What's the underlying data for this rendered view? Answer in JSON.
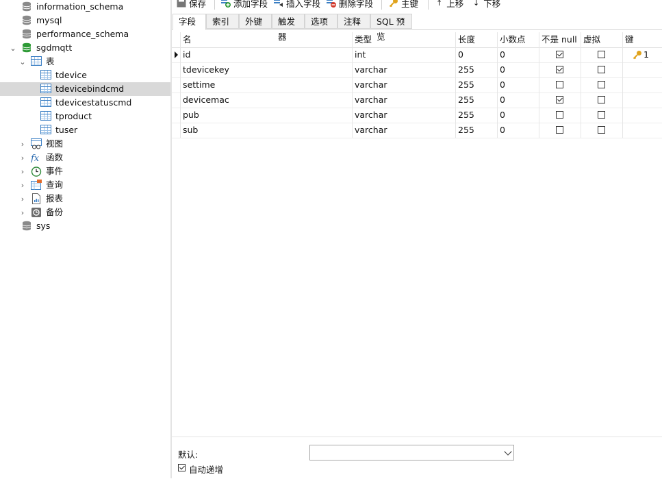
{
  "tree": {
    "items": [
      {
        "label": "information_schema",
        "icon": "database-icon"
      },
      {
        "label": "mysql",
        "icon": "database-icon"
      },
      {
        "label": "performance_schema",
        "icon": "database-icon"
      },
      {
        "label": "sgdmqtt",
        "icon": "database-open-icon"
      },
      {
        "label": "表",
        "icon": "tables-folder-icon"
      },
      {
        "label": "tdevice",
        "icon": "table-icon"
      },
      {
        "label": "tdevicebindcmd",
        "icon": "table-icon"
      },
      {
        "label": "tdevicestatuscmd",
        "icon": "table-icon"
      },
      {
        "label": "tproduct",
        "icon": "table-icon"
      },
      {
        "label": "tuser",
        "icon": "table-icon"
      },
      {
        "label": "视图",
        "icon": "view-icon"
      },
      {
        "label": "函数",
        "icon": "function-icon"
      },
      {
        "label": "事件",
        "icon": "event-clock-icon"
      },
      {
        "label": "查询",
        "icon": "query-icon"
      },
      {
        "label": "报表",
        "icon": "report-icon"
      },
      {
        "label": "备份",
        "icon": "backup-icon"
      },
      {
        "label": "sys",
        "icon": "database-icon"
      }
    ]
  },
  "toolbar": {
    "save": "保存",
    "add_field": "添加字段",
    "insert_field": "插入字段",
    "delete_field": "删除字段",
    "primary_key": "主键",
    "move_up": "上移",
    "move_down": "下移"
  },
  "tabs": [
    "字段",
    "索引",
    "外键",
    "触发器",
    "选项",
    "注释",
    "SQL 预览"
  ],
  "grid": {
    "headers": [
      "名",
      "类型",
      "长度",
      "小数点",
      "不是 null",
      "虚拟",
      "键"
    ],
    "rows": [
      {
        "name": "id",
        "type": "int",
        "length": "0",
        "decimals": "0",
        "not_null": true,
        "virtual": false,
        "key": "1"
      },
      {
        "name": "tdevicekey",
        "type": "varchar",
        "length": "255",
        "decimals": "0",
        "not_null": true,
        "virtual": false,
        "key": ""
      },
      {
        "name": "settime",
        "type": "varchar",
        "length": "255",
        "decimals": "0",
        "not_null": false,
        "virtual": false,
        "key": ""
      },
      {
        "name": "devicemac",
        "type": "varchar",
        "length": "255",
        "decimals": "0",
        "not_null": true,
        "virtual": false,
        "key": ""
      },
      {
        "name": "pub",
        "type": "varchar",
        "length": "255",
        "decimals": "0",
        "not_null": false,
        "virtual": false,
        "key": ""
      },
      {
        "name": "sub",
        "type": "varchar",
        "length": "255",
        "decimals": "0",
        "not_null": false,
        "virtual": false,
        "key": ""
      }
    ]
  },
  "bottom": {
    "default_label": "默认:",
    "default_value": "",
    "auto_increment_label": "自动递增",
    "auto_increment_checked": true
  },
  "colors": {
    "accent": "#3b7fc4",
    "db_green": "#3aa53a",
    "key_gold": "#e0a31c",
    "selected_row": "#d9d9d9"
  }
}
